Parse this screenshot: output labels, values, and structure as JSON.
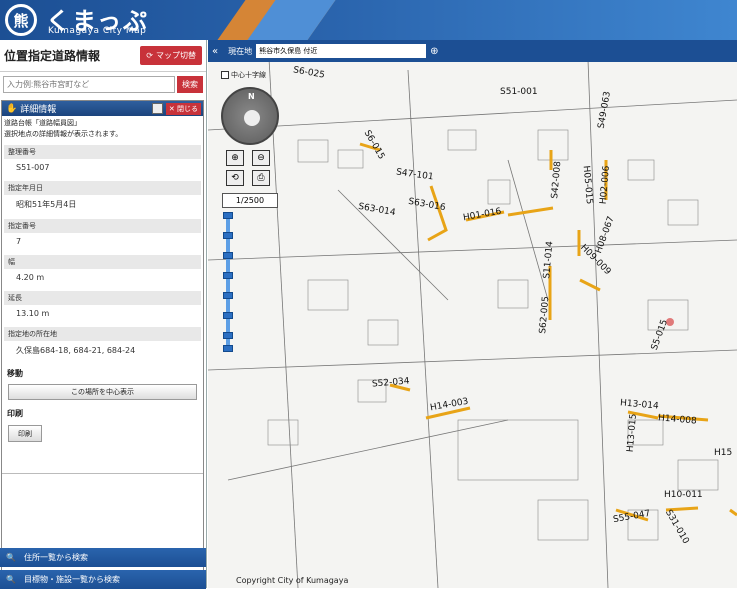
{
  "header": {
    "logo_ja": "くまっぷ",
    "logo_en": "Kumagaya City Map",
    "emblem": "熊"
  },
  "left": {
    "title": "位置指定道路情報",
    "map_switch_label": "マップ切替",
    "search_placeholder": "入力例:熊谷市宮町など",
    "search_button": "検索",
    "detail": {
      "header_label": "詳細情報",
      "close_label": "閉じる",
      "desc_line1": "道路台帳「道路幅員図」",
      "desc_line2": "選択地点の詳細情報が表示されます。",
      "fields": [
        {
          "label": "整理番号",
          "value": "S51-007"
        },
        {
          "label": "指定年月日",
          "value": "昭和51年5月4日"
        },
        {
          "label": "指定番号",
          "value": "7"
        },
        {
          "label": "幅",
          "value": "4.20 m"
        },
        {
          "label": "延長",
          "value": "13.10 m"
        },
        {
          "label": "指定地の所在地",
          "value": "久保島684-18, 684-21, 684-24"
        }
      ],
      "move_section": "移動",
      "center_button": "この場所を中心表示",
      "print_section": "印刷",
      "print_button": "印刷"
    },
    "bottom_bars": [
      {
        "label": "住所一覧から検索"
      },
      {
        "label": "目標物・施設一覧から検索"
      }
    ]
  },
  "map": {
    "collapse_icon": "«",
    "current_location_label": "現在地",
    "address": "熊谷市久保島 付近",
    "checkbox_label": "中心十字線",
    "north": "N",
    "scale": "1/2500",
    "copyright": "Copyright City of Kumagaya",
    "road_labels": [
      "S51-001",
      "S49-063",
      "S6-015",
      "S47-101",
      "S42-008",
      "H05-015",
      "H02-006",
      "S63-014",
      "S63-016",
      "H01-016",
      "H08-067",
      "H09-009",
      "S11-014",
      "S62-005",
      "S52-034",
      "H14-003",
      "H13-014",
      "H14-008",
      "H15",
      "S55-047",
      "H10-011",
      "S31-010",
      "S5-015",
      "H13-015",
      "S6-025"
    ],
    "accent_color": "#e8a417"
  }
}
